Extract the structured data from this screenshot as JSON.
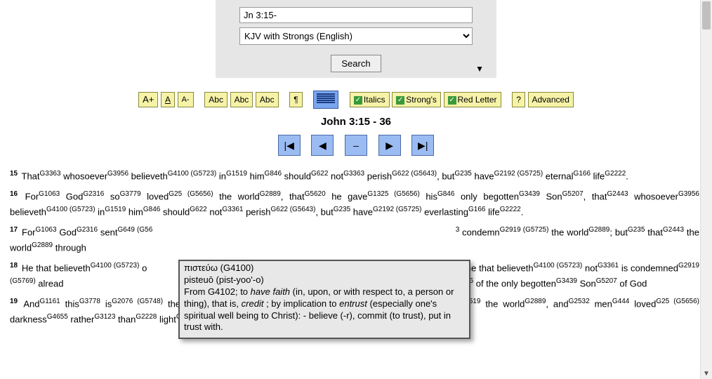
{
  "search": {
    "query": "Jn 3:15-",
    "version": "KJV with Strongs (English)",
    "button": "Search",
    "toggle": "▼"
  },
  "toolbar": {
    "fs_up": "A+",
    "fs_mid": "A",
    "fs_down": "A-",
    "abc1": "Abc",
    "abc2": "Abc",
    "abc3": "Abc",
    "pilcrow": "¶",
    "italics": "Italics",
    "strongs": "Strong's",
    "redletter": "Red Letter",
    "help": "?",
    "advanced": "Advanced"
  },
  "heading": "John 3:15 - 36",
  "nav": {
    "first": "|◀",
    "prev": "◀",
    "center": "–",
    "next": "▶",
    "last": "▶|"
  },
  "tooltip": {
    "l1": "πιστεύω   (G4100)",
    "l2": "pisteuō (pist-yoo'-o)",
    "l3": "From G4102; to <i>have faith</i> (in, upon, or with respect to, a person or thing), that is, <i>credit</i> ; by implication to <i>entrust</i> (especially one's spiritual well being to Christ): - believe (-r), commit (to trust), put in trust with."
  },
  "verses": [
    {
      "n": "15",
      "html": "That<sup class='st'>G3363</sup> whosoever<sup class='st'>G3956</sup> believeth<sup class='st'>G4100 (G5723)</sup> in<sup class='st'>G1519</sup> him<sup class='st'>G846</sup> should<sup class='st'>G622</sup> not<sup class='st'>G3363</sup> perish<sup class='st'>G622 (G5643)</sup>, but<sup class='st'>G235</sup> have<sup class='st'>G2192 (G5725)</sup> eternal<sup class='st'>G166</sup> life<sup class='st'>G2222</sup>."
    },
    {
      "n": "16",
      "html": "For<sup class='st'>G1063</sup> God<sup class='st'>G2316</sup> so<sup class='st'>G3779</sup> loved<sup class='st'>G25 (G5656)</sup> the world<sup class='st'>G2889</sup>, that<sup class='st'>G5620</sup> he gave<sup class='st'>G1325 (G5656)</sup> his<sup class='st'>G846</sup> only begotten<sup class='st'>G3439</sup> Son<sup class='st'>G5207</sup>, that<sup class='st'>G2443</sup> whosoever<sup class='st'>G3956</sup> believeth<sup class='st'>G4100 (G5723)</sup> in<sup class='st'>G1519</sup> him<sup class='st'>G846</sup> should<sup class='st'>G622</sup> not<sup class='st'>G3361</sup> perish<sup class='st'>G622 (G5643)</sup>, but<sup class='st'>G235</sup> have<sup class='st'>G2192 (G5725)</sup> everlasting<sup class='st'>G166</sup> life<sup class='st'>G2222</sup>."
    },
    {
      "n": "17",
      "html": "For<sup class='st'>G1063</sup> God<sup class='st'>G2316</sup> sent<sup class='st'>G649 (G56</sup> &nbsp;&nbsp;&nbsp;&nbsp;&nbsp;&nbsp;&nbsp;&nbsp;&nbsp;&nbsp;&nbsp;&nbsp;&nbsp;&nbsp;&nbsp;&nbsp;&nbsp;&nbsp;&nbsp;&nbsp;&nbsp;&nbsp;&nbsp;&nbsp;&nbsp;&nbsp;&nbsp;&nbsp;&nbsp;&nbsp;&nbsp;&nbsp;&nbsp;&nbsp;&nbsp;&nbsp;&nbsp;&nbsp;&nbsp;&nbsp;&nbsp;&nbsp;&nbsp;&nbsp;&nbsp;&nbsp;&nbsp;&nbsp;&nbsp;&nbsp;&nbsp;&nbsp;&nbsp;&nbsp;&nbsp;&nbsp;&nbsp;&nbsp;&nbsp;&nbsp;&nbsp;&nbsp;&nbsp;&nbsp;&nbsp;&nbsp;&nbsp;&nbsp;&nbsp;&nbsp;&nbsp;&nbsp;&nbsp;&nbsp;&nbsp;&nbsp;&nbsp;&nbsp;&nbsp;&nbsp;&nbsp;&nbsp;&nbsp;&nbsp;&nbsp;&nbsp;&nbsp;&nbsp;&nbsp;&nbsp;&nbsp;&nbsp;&nbsp;&nbsp;&nbsp;&nbsp;&nbsp;&nbsp;&nbsp;&nbsp;&nbsp;&nbsp;&nbsp;&nbsp;&nbsp;&nbsp;&nbsp;&nbsp;&nbsp;&nbsp;<sup class='st'>3</sup> condemn<sup class='st'>G2919 (G5725)</sup> the world<sup class='st'>G2889</sup>; but<sup class='st'>G235</sup> that<sup class='st'>G2443</sup> the world<sup class='st'>G2889</sup> through<sup class='st'></sup>"
    },
    {
      "n": "18",
      "html": "He that believeth<sup class='st'>G4100 (G5723)</sup> o&nbsp;&nbsp;&nbsp;&nbsp;&nbsp;&nbsp;&nbsp;&nbsp;&nbsp;&nbsp;&nbsp;&nbsp;&nbsp;&nbsp;&nbsp;&nbsp;&nbsp;&nbsp;&nbsp;&nbsp;&nbsp;&nbsp;&nbsp;&nbsp;&nbsp;&nbsp;&nbsp;&nbsp;&nbsp;&nbsp;&nbsp;&nbsp;&nbsp;&nbsp;&nbsp;&nbsp;&nbsp;&nbsp;&nbsp;&nbsp;&nbsp;&nbsp;&nbsp;&nbsp;&nbsp;&nbsp;&nbsp;&nbsp;&nbsp;&nbsp;&nbsp;&nbsp;&nbsp;&nbsp;&nbsp;&nbsp;&nbsp;&nbsp;&nbsp;&nbsp;&nbsp;&nbsp;&nbsp;&nbsp;&nbsp;&nbsp;&nbsp;&nbsp;&nbsp;&nbsp;&nbsp;&nbsp;&nbsp;&nbsp;&nbsp;&nbsp;&nbsp;&nbsp;&nbsp;&nbsp;&nbsp;&nbsp;&nbsp;&nbsp;&nbsp;&nbsp;&nbsp;&nbsp;&nbsp;&nbsp;&nbsp;&nbsp;&nbsp;&nbsp;&nbsp;&nbsp;&nbsp;&nbsp;&nbsp;&nbsp;&nbsp;&nbsp;&nbsp;&nbsp;&nbsp;&nbsp;&nbsp;&nbsp;&nbsp;&nbsp;&nbsp;&nbsp;<sup class='st'>G1161</sup> he that believeth<sup class='st'>G4100 (G5723)</sup> not<sup class='st'>G3361</sup> is condemned<sup class='st'>G2919 (G5769)</sup> alread&nbsp;&nbsp;&nbsp;&nbsp;&nbsp;&nbsp;&nbsp;&nbsp;&nbsp;&nbsp;&nbsp;&nbsp;&nbsp;&nbsp;&nbsp;&nbsp;&nbsp;&nbsp;&nbsp;&nbsp;&nbsp;&nbsp;&nbsp;&nbsp;&nbsp;&nbsp;&nbsp;&nbsp;&nbsp;&nbsp;&nbsp;&nbsp;&nbsp;&nbsp;&nbsp;&nbsp;&nbsp;&nbsp;&nbsp;&nbsp;&nbsp;&nbsp;&nbsp;&nbsp;&nbsp;&nbsp;&nbsp;&nbsp;&nbsp;&nbsp;&nbsp;&nbsp;&nbsp;&nbsp;&nbsp;&nbsp;&nbsp;&nbsp;&nbsp;&nbsp;&nbsp;&nbsp;&nbsp;&nbsp;&nbsp;&nbsp;&nbsp;&nbsp;&nbsp;&nbsp;&nbsp;&nbsp;&nbsp;&nbsp;&nbsp;&nbsp;&nbsp;&nbsp;&nbsp;&nbsp;&nbsp;&nbsp;&nbsp;&nbsp;&nbsp;&nbsp;&nbsp;&nbsp;&nbsp;&nbsp;&nbsp;&nbsp;&nbsp;&nbsp;&nbsp;&nbsp;&nbsp;&nbsp;&nbsp;&nbsp;&nbsp;&nbsp;&nbsp;&nbsp;&nbsp;&nbsp;&nbsp;&nbsp;&nbsp;&nbsp;&nbsp;&nbsp;&nbsp;&nbsp;&nbsp;<sup class='st'>(G5758)</sup> in<sup class='st'>G1519</sup> the name<sup class='st'>G3686</sup> of the only begotten<sup class='st'>G3439</sup> Son<sup class='st'>G5207</sup> of God<sup class='st'></sup>"
    },
    {
      "n": "19",
      "html": "And<sup class='st'>G1161</sup> this<sup class='st'>G3778</sup> is<sup class='st'>G2076 (G5748)</sup> the condemnation<sup class='st'>G2920</sup>, that<sup class='st'>G3754</sup> light<sup class='st'>G5457</sup> is come<sup class='st'>G2064 (G5754)</sup> into<sup class='st'>G1519</sup> the world<sup class='st'>G2889</sup>, and<sup class='st'>G2532</sup> men<sup class='st'>G444</sup> loved<sup class='st'>G25 (G5656)</sup> darkness<sup class='st'>G4655</sup> rather<sup class='st'>G3123</sup> than<sup class='st'>G2228</sup> light<sup class='st'>G5457</sup>, because<sup class='st'>G1063</sup> their<sup class='st'>G846</sup> deeds<sup class='st'>G2041</sup> were<sup class='st'>G2258 (G5713)</sup> evil<sup class='st'>G4190</sup>."
    }
  ]
}
